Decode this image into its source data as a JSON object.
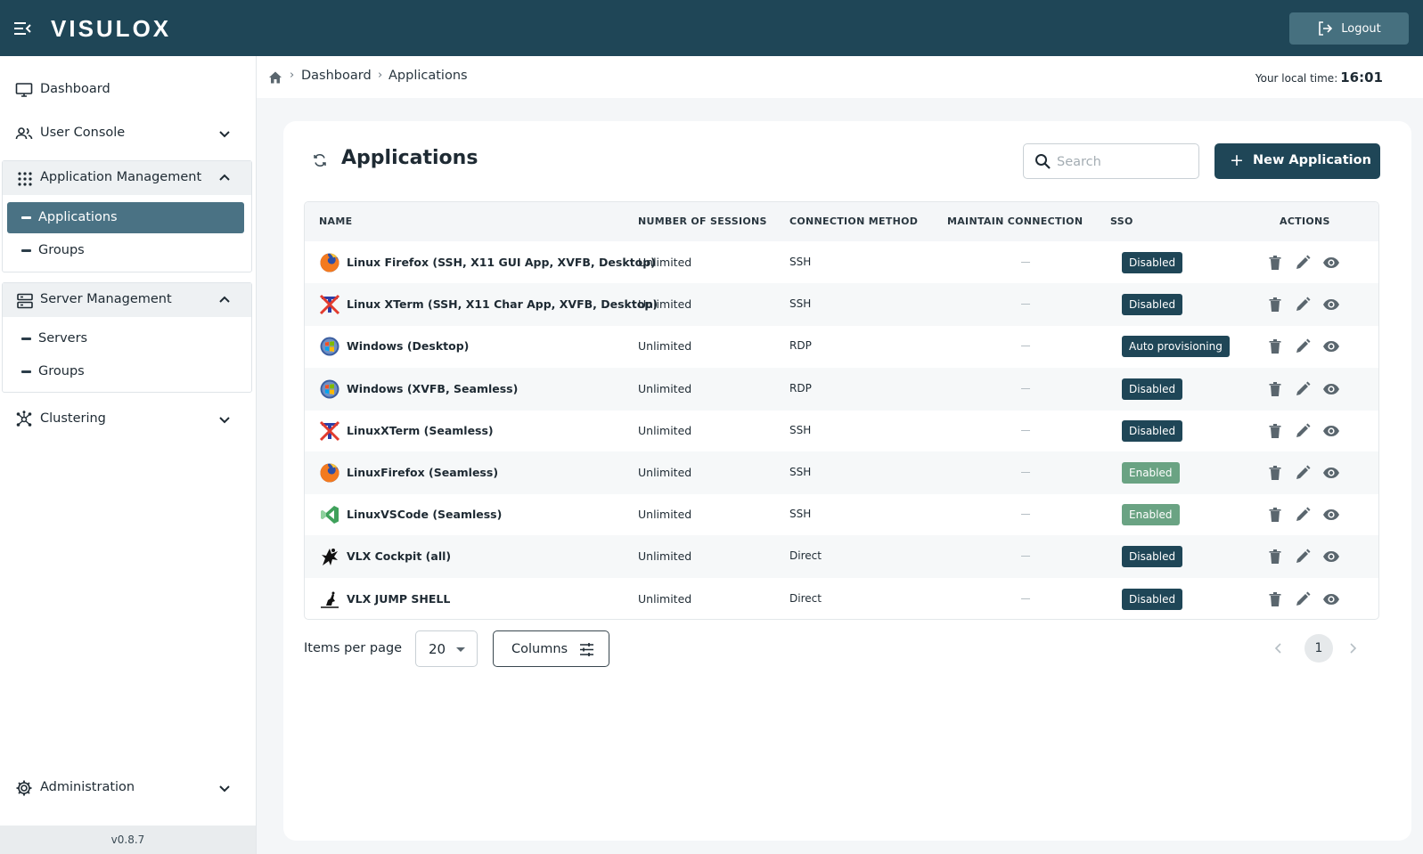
{
  "header": {
    "logo_text": "VISULOX",
    "logout_label": "Logout"
  },
  "sidebar": {
    "dashboard": "Dashboard",
    "user_console": "User Console",
    "application_management": "Application Management",
    "app_mgmt_items": [
      "Applications",
      "Groups"
    ],
    "server_management": "Server Management",
    "server_mgmt_items": [
      "Servers",
      "Groups"
    ],
    "clustering": "Clustering",
    "administration": "Administration",
    "version": "v0.8.7"
  },
  "breadcrumb": {
    "items": [
      "Dashboard",
      "Applications"
    ],
    "local_time_label": "Your local time:",
    "local_time": "16:01"
  },
  "main": {
    "title": "Applications",
    "search_placeholder": "Search",
    "new_button_label": "New Application",
    "columns": [
      "NAME",
      "NUMBER OF SESSIONS",
      "CONNECTION METHOD",
      "MAINTAIN CONNECTION",
      "SSO",
      "ACTIONS"
    ],
    "rows": [
      {
        "icon": "firefox-icon",
        "name": "Linux Firefox (SSH, X11 GUI App, XVFB, Desktop)",
        "sessions": "Unlimited",
        "method": "SSH",
        "maintain": "—",
        "sso": "Disabled"
      },
      {
        "icon": "xterm-icon",
        "name": "Linux XTerm (SSH, X11 Char App, XVFB, Desktop)",
        "sessions": "Unlimited",
        "method": "SSH",
        "maintain": "—",
        "sso": "Disabled"
      },
      {
        "icon": "windows-icon",
        "name": "Windows (Desktop)",
        "sessions": "Unlimited",
        "method": "RDP",
        "maintain": "—",
        "sso": "Auto provisioning"
      },
      {
        "icon": "windows-icon",
        "name": "Windows (XVFB, Seamless)",
        "sessions": "Unlimited",
        "method": "RDP",
        "maintain": "—",
        "sso": "Disabled"
      },
      {
        "icon": "xterm-icon",
        "name": "LinuxXTerm (Seamless)",
        "sessions": "Unlimited",
        "method": "SSH",
        "maintain": "—",
        "sso": "Disabled"
      },
      {
        "icon": "firefox-icon",
        "name": "LinuxFirefox (Seamless)",
        "sessions": "Unlimited",
        "method": "SSH",
        "maintain": "—",
        "sso": "Enabled"
      },
      {
        "icon": "vscode-icon",
        "name": "LinuxVSCode (Seamless)",
        "sessions": "Unlimited",
        "method": "SSH",
        "maintain": "—",
        "sso": "Enabled"
      },
      {
        "icon": "cockpit-icon",
        "name": "VLX Cockpit (all)",
        "sessions": "Unlimited",
        "method": "Direct",
        "maintain": "—",
        "sso": "Disabled"
      },
      {
        "icon": "jump-shell-icon",
        "name": "VLX JUMP SHELL",
        "sessions": "Unlimited",
        "method": "Direct",
        "maintain": "—",
        "sso": "Disabled"
      }
    ],
    "items_per_page_label": "Items per page",
    "items_per_page_value": "20",
    "columns_button_label": "Columns",
    "current_page": "1"
  },
  "colors": {
    "topbar": "#1f4657",
    "badge_disabled": "#1f4657",
    "badge_enabled": "#6aa383",
    "active_nav": "#4a7284"
  }
}
